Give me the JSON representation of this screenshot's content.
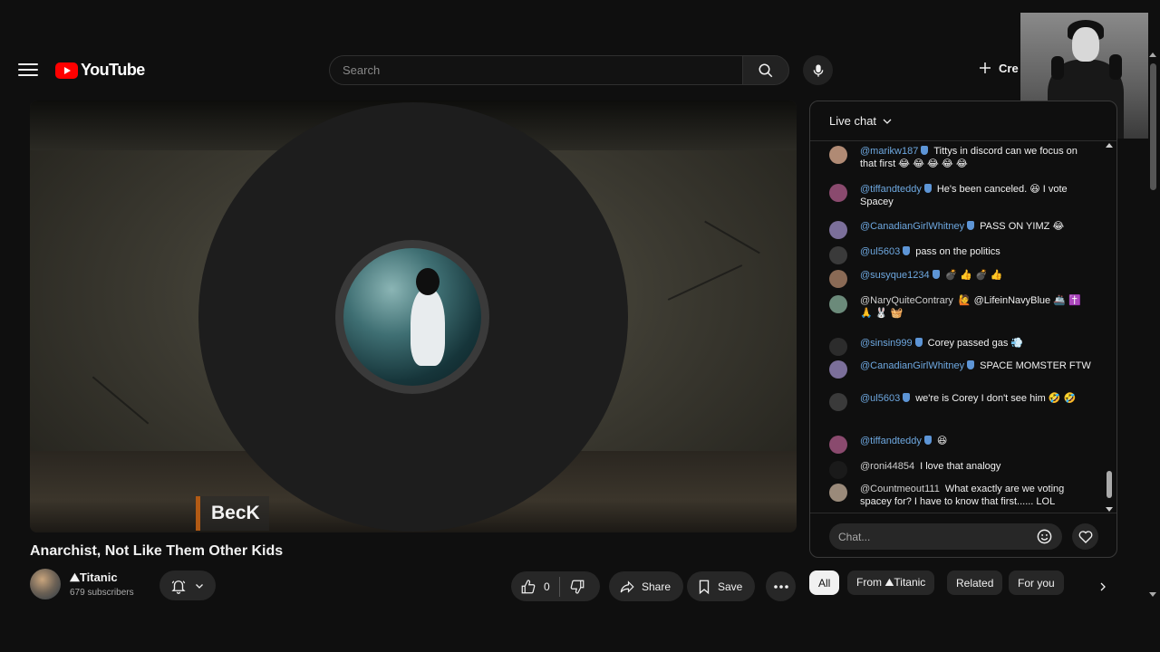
{
  "header": {
    "logo_text": "YouTube",
    "search_placeholder": "Search",
    "create_label": "Cre"
  },
  "player": {
    "caption": "BecK"
  },
  "video": {
    "title": "Anarchist, Not Like Them Other Kids",
    "channel": "⛰Titanic",
    "subscribers": "679 subscribers",
    "like_count": "0",
    "share_label": "Share",
    "save_label": "Save"
  },
  "chat": {
    "header": "Live chat",
    "input_placeholder": "Chat...",
    "messages": [
      {
        "author": "@marikw187",
        "verified": true,
        "text": "Tittys in discord can we focus on that first 😂 😂 😂 😂 😂",
        "avatar_color": "#b08a74"
      },
      {
        "author": "@tiffandteddy",
        "verified": true,
        "text": "He's been canceled. 😆 I vote Spacey",
        "avatar_color": "#8a4a6e"
      },
      {
        "author": "@CanadianGirlWhitney",
        "verified": true,
        "text": "PASS ON YIMZ 😂",
        "avatar_color": "#7b6f9a"
      },
      {
        "author": "@ul5603",
        "verified": true,
        "text": "pass on the politics",
        "avatar_color": "#3a3a3a"
      },
      {
        "author": "@susyque1234",
        "verified": true,
        "text": "💣 👍 💣 👍",
        "avatar_color": "#8a6a55"
      },
      {
        "author": "@NaryQuiteContrary",
        "verified": false,
        "text": "🙋 @LifeinNavyBlue 🚢 ✝️ 🙏 🐰 🧺",
        "avatar_color": "#6b8a7a"
      },
      {
        "author": "@sinsin999",
        "verified": true,
        "text": "Corey passed gas 💨",
        "avatar_color": "#2c2c2c"
      },
      {
        "author": "@CanadianGirlWhitney",
        "verified": true,
        "text": "SPACE MOMSTER FTW",
        "avatar_color": "#7b6f9a"
      },
      {
        "author": "@ul5603",
        "verified": true,
        "text": "we're is Corey I don't see him 🤣 🤣",
        "avatar_color": "#3a3a3a"
      },
      {
        "author": "@tiffandteddy",
        "verified": true,
        "text": "😆",
        "avatar_color": "#8a4a6e"
      },
      {
        "author": "@roni44854",
        "verified": false,
        "text": "I love that analogy",
        "avatar_color": "#1a1a1a"
      },
      {
        "author": "@Countmeout111",
        "verified": false,
        "text": "What exactly are we voting spacey for? I have to know that first...... LOL",
        "avatar_color": "#9a8a7a"
      }
    ]
  },
  "chips": [
    "All",
    "From ⛰Titanic",
    "Related",
    "For you"
  ],
  "colors": {
    "background": "#0f0f0f",
    "brand_red": "#ff0000",
    "author_blue": "#6ea8e0",
    "chip_active": "#f1f1f1"
  }
}
